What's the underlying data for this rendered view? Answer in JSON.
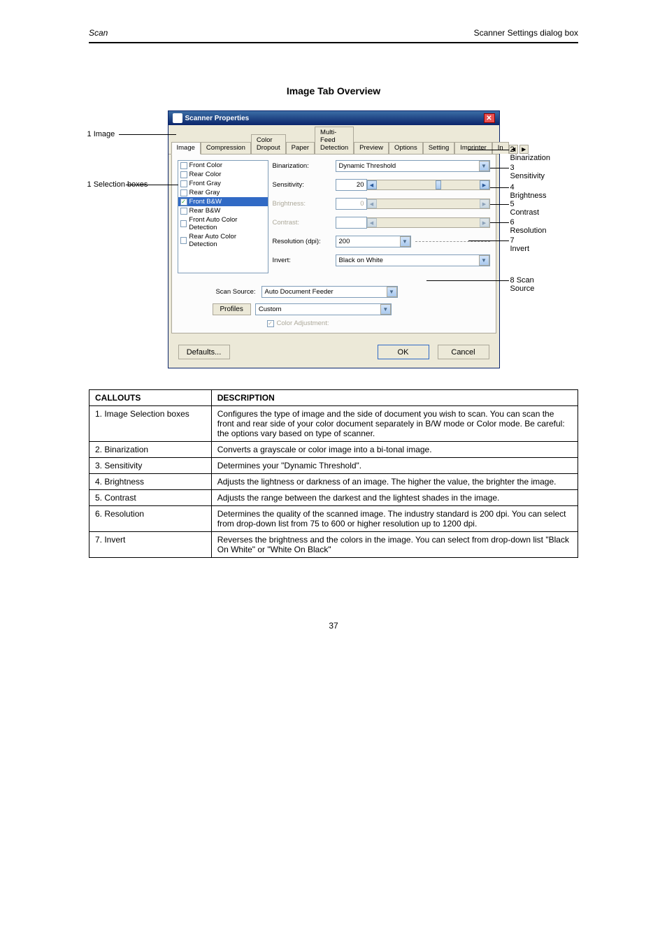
{
  "header": {
    "left": "Scan",
    "right": "Scanner Settings dialog box"
  },
  "subheader": "Image Tab Overview",
  "dialog": {
    "title": "Scanner Properties",
    "tabs": [
      "Image",
      "Compression",
      "Color Dropout",
      "Paper",
      "Multi-Feed Detection",
      "Preview",
      "Options",
      "Setting",
      "Imprinter",
      "In"
    ],
    "selection": [
      "Front Color",
      "Rear Color",
      "Front Gray",
      "Rear Gray",
      "Front B&W",
      "Rear B&W",
      "Front Auto Color Detection",
      "Rear Auto Color Detection"
    ],
    "labels": {
      "binarization": "Binarization:",
      "sensitivity": "Sensitivity:",
      "brightness": "Brightness:",
      "contrast": "Contrast:",
      "resolution": "Resolution (dpi):",
      "invert": "Invert:",
      "scansource": "Scan Source:",
      "profiles": "Profiles",
      "coloradj": "Color Adjustment:"
    },
    "vals": {
      "binarization": "Dynamic Threshold",
      "sensitivity": "20",
      "brightness": "0",
      "resolution": "200",
      "invert": "Black on White",
      "scansource": "Auto Document Feeder",
      "profiles": "Custom"
    },
    "buttons": {
      "defaults": "Defaults...",
      "ok": "OK",
      "cancel": "Cancel"
    }
  },
  "callouts": {
    "c1": "Image",
    "c2": "Selection boxes",
    "c3": "Binarization",
    "c4": "Sensitivity",
    "c5": "Brightness",
    "c6": "Contrast",
    "c7": "Resolution",
    "c8": "Invert",
    "c9": "Scan Source"
  },
  "table": {
    "h1": "CALLOUTS",
    "h2": "DESCRIPTION",
    "rows": [
      [
        "1. Image Selection boxes",
        "Configures the type of image and the side of document you wish to scan. You can scan the front and rear side of your color document separately in B/W mode or Color mode. Be careful: the options vary based on type of scanner."
      ],
      [
        "2. Binarization",
        "Converts a grayscale or color image into a bi-tonal image."
      ],
      [
        "3. Sensitivity",
        "Determines your \"Dynamic Threshold\"."
      ],
      [
        "4. Brightness",
        "Adjusts the lightness or darkness of an image. The higher the value, the brighter the image."
      ],
      [
        "5. Contrast",
        "Adjusts the range between the darkest and the lightest shades in the image."
      ],
      [
        "6. Resolution",
        "Determines the quality of the scanned image. The industry standard is 200 dpi. You can select from drop-down list from 75 to 600 or higher resolution up to 1200 dpi."
      ],
      [
        "7. Invert",
        "Reverses the brightness and the colors in the image. You can select from drop-down list \"Black On White\" or \"White On Black\""
      ]
    ]
  },
  "footer": "37"
}
